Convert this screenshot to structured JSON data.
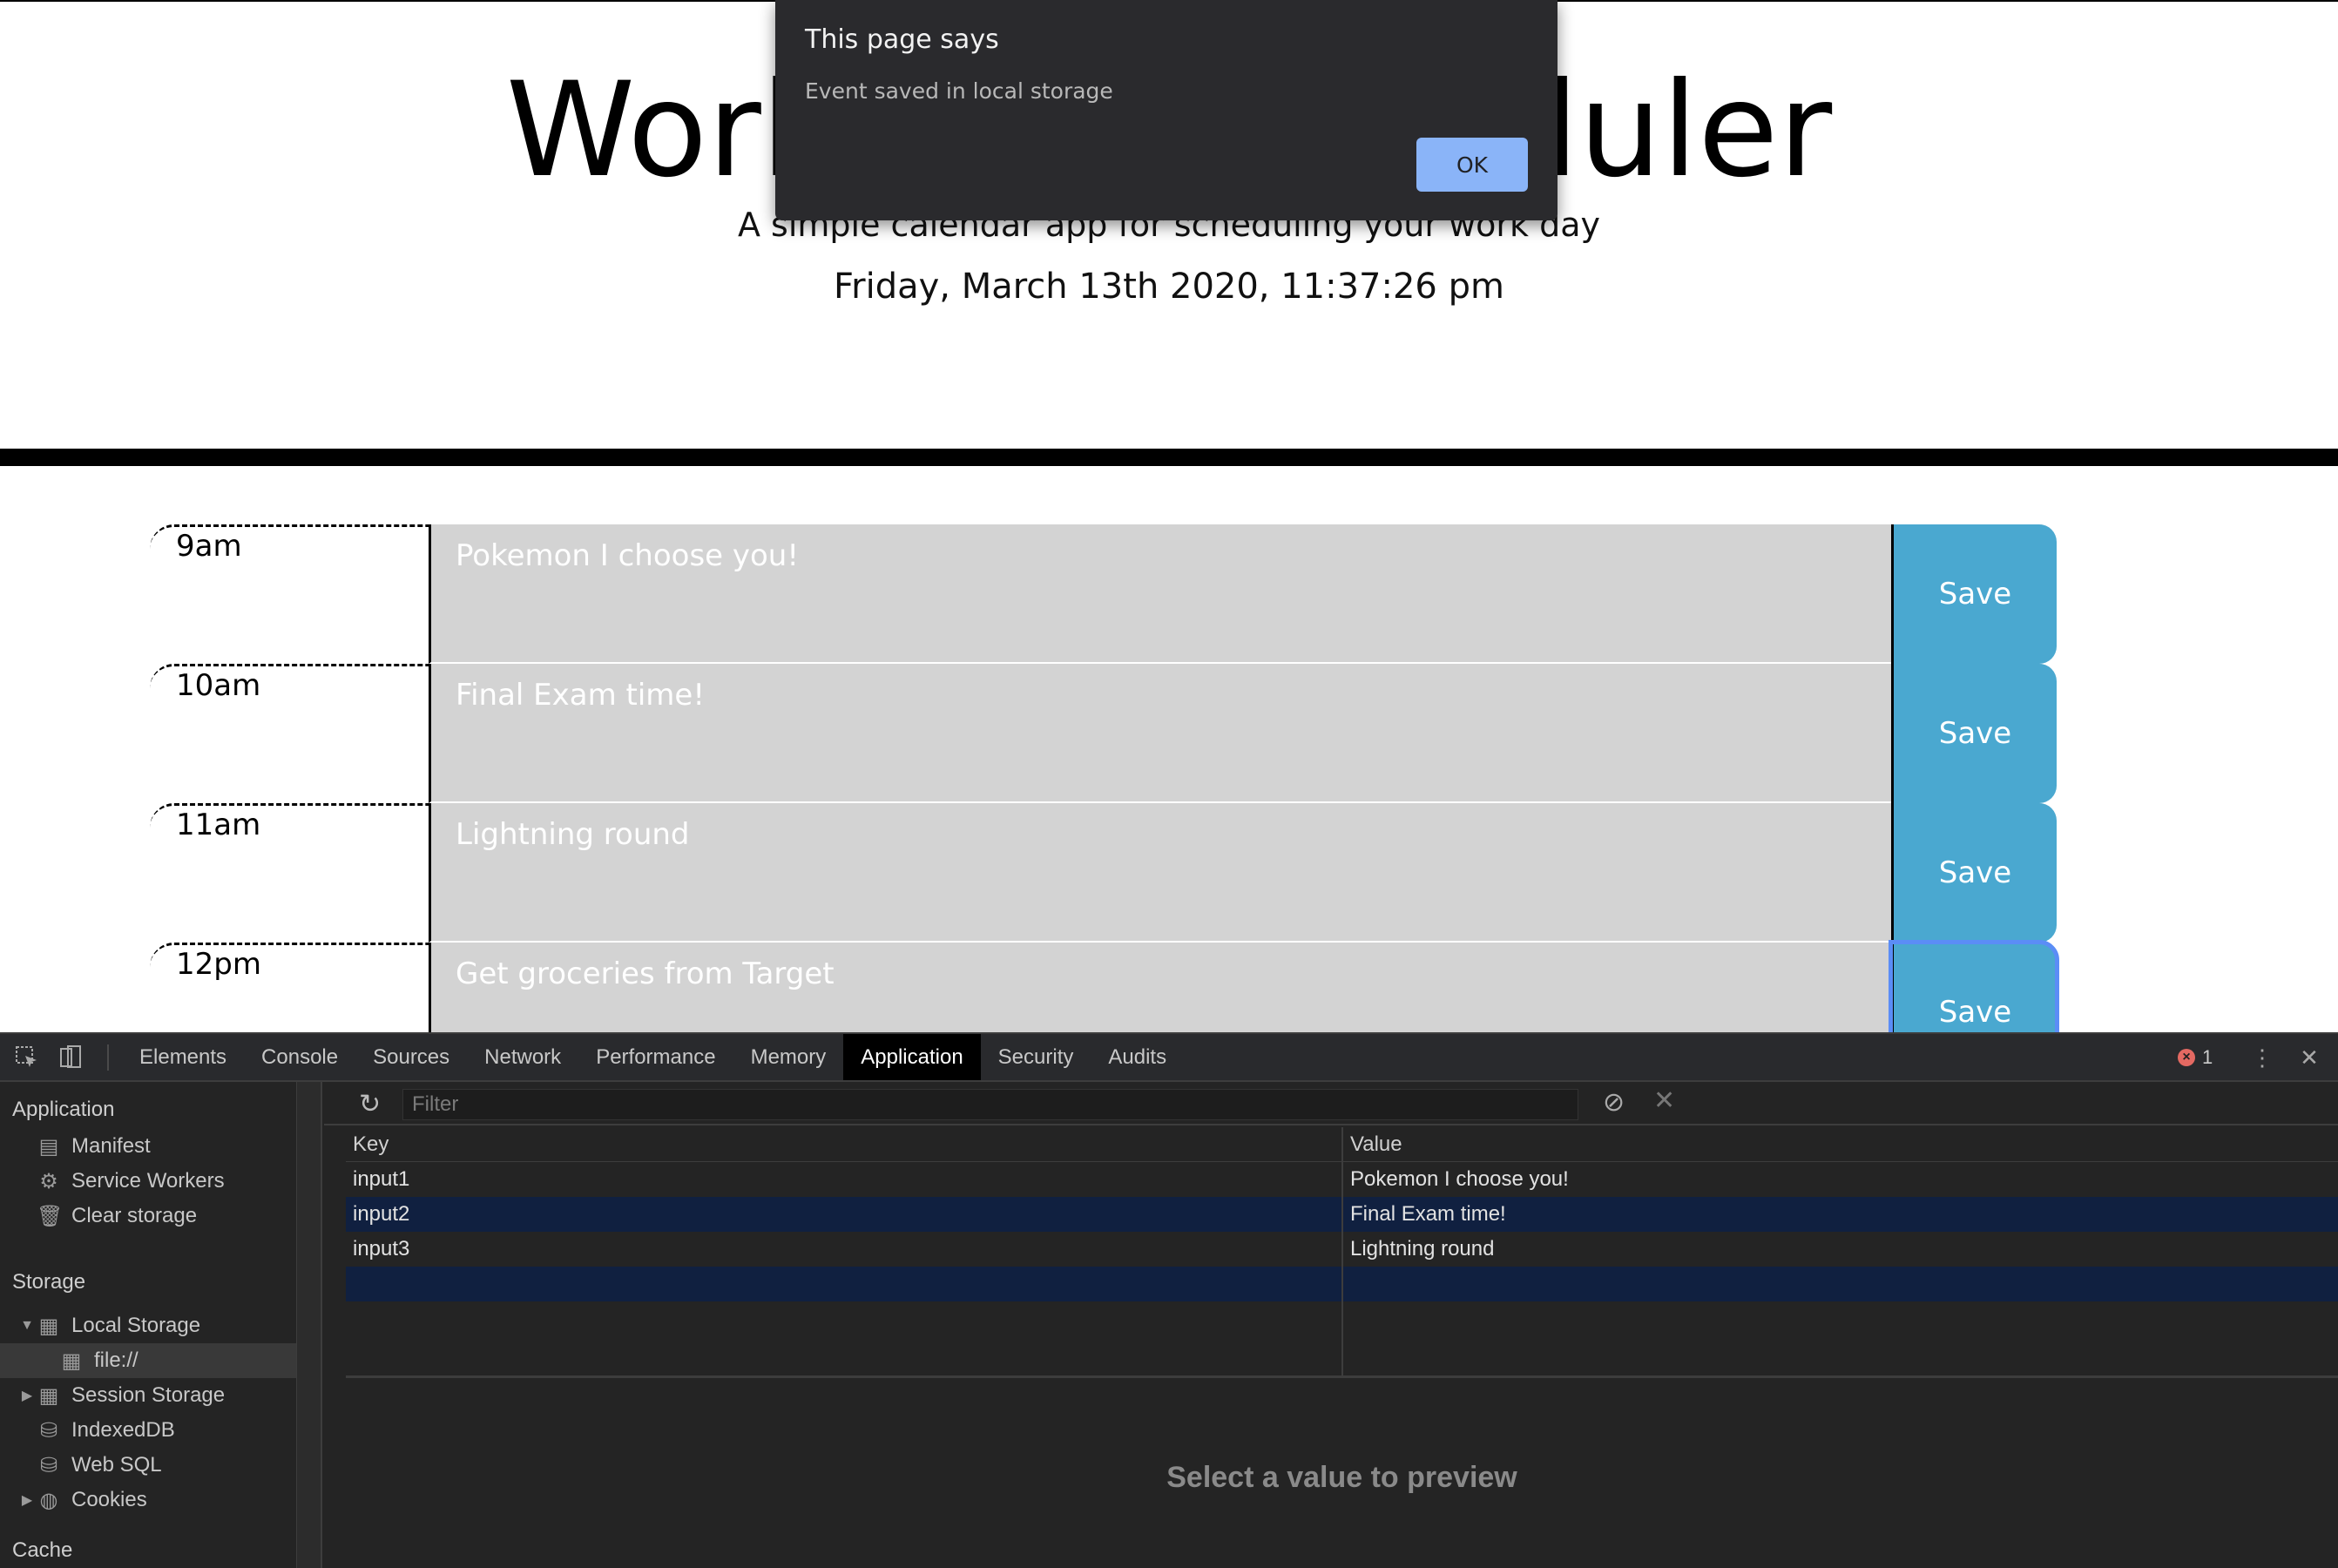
{
  "scheduler": {
    "title": "Work Day Scheduler",
    "subtitle": "A simple calendar app for scheduling your work day",
    "current_day": "Friday, March 13th 2020, 11:37:26 pm",
    "save_label": "Save",
    "rows": [
      {
        "hour": "9am",
        "text": "Pokemon I choose you!"
      },
      {
        "hour": "10am",
        "text": "Final Exam time!"
      },
      {
        "hour": "11am",
        "text": "Lightning round"
      },
      {
        "hour": "12pm",
        "text": "Get groceries from Target"
      }
    ]
  },
  "alert": {
    "title": "This page says",
    "message": "Event saved in local storage",
    "ok_label": "OK"
  },
  "devtools": {
    "tabs": [
      "Elements",
      "Console",
      "Sources",
      "Network",
      "Performance",
      "Memory",
      "Application",
      "Security",
      "Audits"
    ],
    "active_tab": "Application",
    "error_count": "1",
    "sidebar": {
      "application_heading": "Application",
      "manifest": "Manifest",
      "service_workers": "Service Workers",
      "clear_storage": "Clear storage",
      "storage_heading": "Storage",
      "local_storage": "Local Storage",
      "local_storage_origin": "file://",
      "session_storage": "Session Storage",
      "indexeddb": "IndexedDB",
      "web_sql": "Web SQL",
      "cookies": "Cookies",
      "cache_heading": "Cache"
    },
    "filter_placeholder": "Filter",
    "grid": {
      "key_header": "Key",
      "value_header": "Value",
      "rows": [
        {
          "key": "input1",
          "value": "Pokemon I choose you!"
        },
        {
          "key": "input2",
          "value": "Final Exam time!"
        },
        {
          "key": "input3",
          "value": "Lightning round"
        }
      ]
    },
    "preview_text": "Select a value to preview"
  }
}
